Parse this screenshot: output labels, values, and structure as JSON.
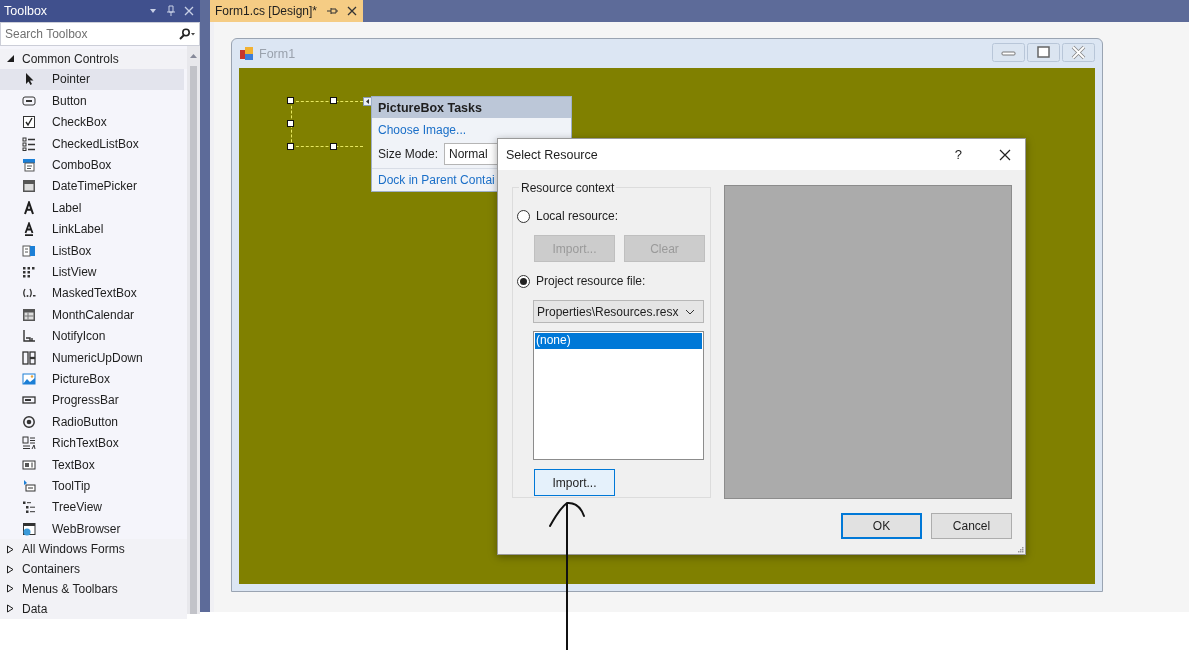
{
  "toolbox": {
    "title": "Toolbox",
    "search": {
      "placeholder": "Search Toolbox"
    },
    "categories": [
      {
        "label": "Common Controls",
        "expanded": true,
        "items": [
          {
            "label": "Pointer",
            "selected": true
          },
          {
            "label": "Button",
            "selected": false
          },
          {
            "label": "CheckBox",
            "selected": false
          },
          {
            "label": "CheckedListBox",
            "selected": false
          },
          {
            "label": "ComboBox",
            "selected": false
          },
          {
            "label": "DateTimePicker",
            "selected": false
          },
          {
            "label": "Label",
            "selected": false
          },
          {
            "label": "LinkLabel",
            "selected": false
          },
          {
            "label": "ListBox",
            "selected": false
          },
          {
            "label": "ListView",
            "selected": false
          },
          {
            "label": "MaskedTextBox",
            "selected": false
          },
          {
            "label": "MonthCalendar",
            "selected": false
          },
          {
            "label": "NotifyIcon",
            "selected": false
          },
          {
            "label": "NumericUpDown",
            "selected": false
          },
          {
            "label": "PictureBox",
            "selected": false
          },
          {
            "label": "ProgressBar",
            "selected": false
          },
          {
            "label": "RadioButton",
            "selected": false
          },
          {
            "label": "RichTextBox",
            "selected": false
          },
          {
            "label": "TextBox",
            "selected": false
          },
          {
            "label": "ToolTip",
            "selected": false
          },
          {
            "label": "TreeView",
            "selected": false
          },
          {
            "label": "WebBrowser",
            "selected": false
          }
        ]
      },
      {
        "label": "All Windows Forms",
        "expanded": false
      },
      {
        "label": "Containers",
        "expanded": false
      },
      {
        "label": "Menus & Toolbars",
        "expanded": false
      },
      {
        "label": "Data",
        "expanded": false
      }
    ]
  },
  "tabs": [
    {
      "label": "Form1.cs [Design]*",
      "selected": true
    }
  ],
  "form": {
    "title": "Form1"
  },
  "picturebox_tasks": {
    "title": "PictureBox Tasks",
    "choose_image": "Choose Image...",
    "size_mode_label": "Size Mode:",
    "size_mode_value": "Normal",
    "dock_link": "Dock in Parent Contai"
  },
  "dialog": {
    "title": "Select Resource",
    "help": "?",
    "group_title": "Resource context",
    "options": [
      {
        "label": "Local resource:",
        "selected": false
      },
      {
        "label": "Project resource file:",
        "selected": true
      }
    ],
    "local_buttons": [
      {
        "label": "Import...",
        "disabled": true
      },
      {
        "label": "Clear",
        "disabled": true
      }
    ],
    "resource_file": "Properties\\Resources.resx",
    "resources": [
      {
        "label": "(none)",
        "selected": true
      }
    ],
    "import_button": "Import...",
    "buttons": [
      {
        "label": "OK",
        "default": true
      },
      {
        "label": "Cancel",
        "default": false
      }
    ]
  }
}
